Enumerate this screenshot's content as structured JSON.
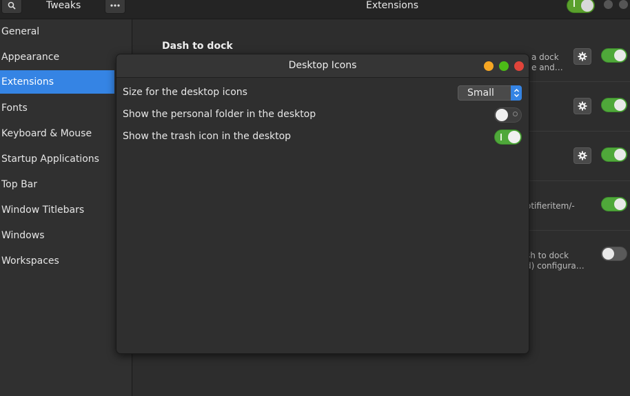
{
  "headerbar": {
    "app_title": "Tweaks",
    "page_title": "Extensions",
    "extensions_master_switch": "on"
  },
  "sidebar": {
    "items": [
      {
        "label": "General"
      },
      {
        "label": "Appearance"
      },
      {
        "label": "Extensions",
        "active": true
      },
      {
        "label": "Fonts"
      },
      {
        "label": "Keyboard & Mouse"
      },
      {
        "label": "Startup Applications"
      },
      {
        "label": "Top Bar"
      },
      {
        "label": "Window Titlebars"
      },
      {
        "label": "Windows"
      },
      {
        "label": "Workspaces"
      }
    ]
  },
  "extensions": {
    "rows": [
      {
        "name": "Dash to dock",
        "desc_line1": "a dock",
        "desc_line2": "e and…",
        "has_settings": true,
        "enabled": true
      },
      {
        "name": "",
        "desc_line1": "",
        "desc_line2": "",
        "has_settings": true,
        "enabled": true
      },
      {
        "name": "",
        "desc_line1": "",
        "desc_line2": "",
        "has_settings": true,
        "enabled": true
      },
      {
        "name": "",
        "desc_line1": "otifieritem/-",
        "desc_line2": "",
        "has_settings": false,
        "enabled": true
      },
      {
        "name": "",
        "desc_line1": "sh to dock",
        "desc_line2": "d) configura…",
        "has_settings": false,
        "enabled": false
      }
    ]
  },
  "dialog": {
    "title": "Desktop Icons",
    "options": [
      {
        "label": "Size for the desktop icons",
        "control": "combo",
        "value": "Small"
      },
      {
        "label": "Show the personal folder in the desktop",
        "control": "switch",
        "value": "off"
      },
      {
        "label": "Show the trash icon in the desktop",
        "control": "switch",
        "value": "on"
      }
    ]
  },
  "colors": {
    "accent": "#3584e4",
    "switch_on": "#4fa83a",
    "dot_minimize": "#f5a623",
    "dot_maximize": "#4cbb17",
    "dot_close": "#e0443a"
  },
  "icons": {
    "search": "search-icon",
    "menu": "more-horizontal-icon",
    "settings": "gear-icon",
    "combo": "up-down-chevron-icon"
  }
}
